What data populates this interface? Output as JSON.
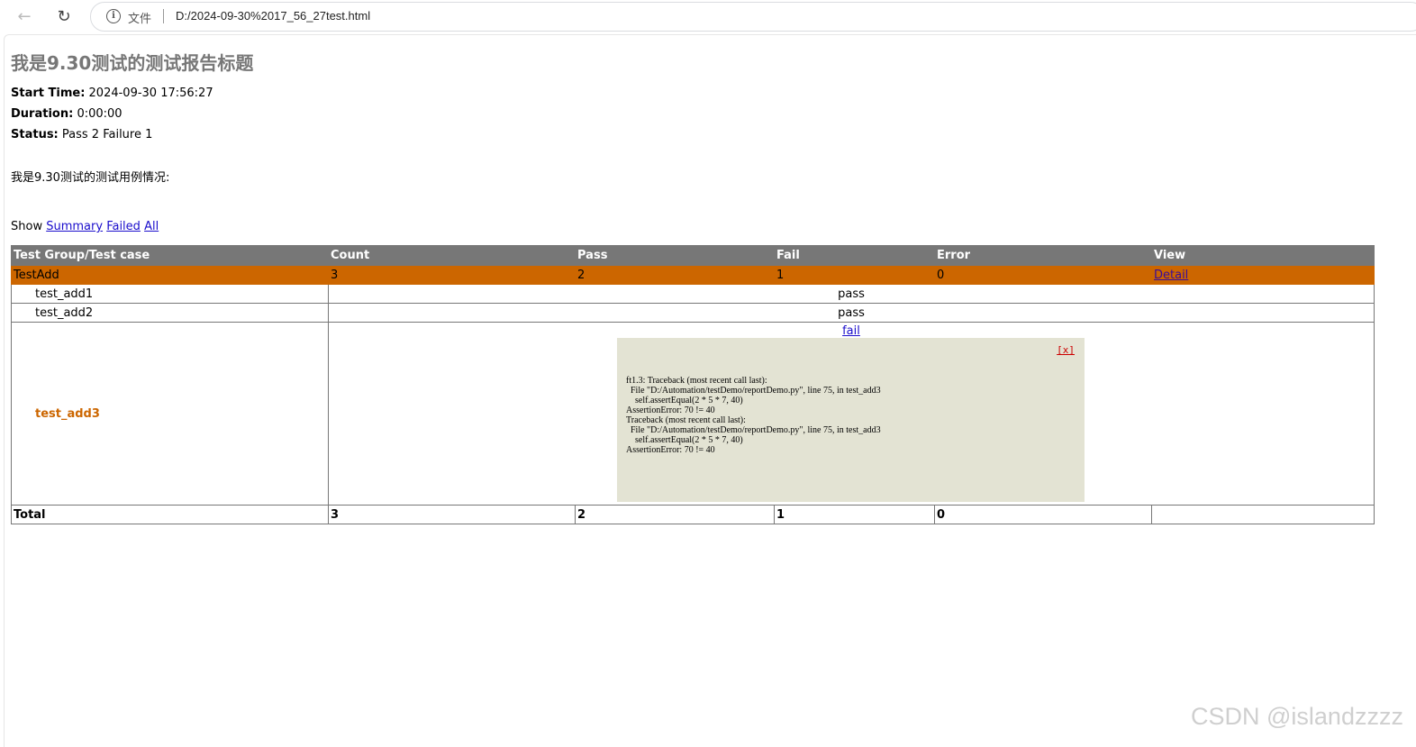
{
  "browser": {
    "scheme_label": "文件",
    "url": "D:/2024-09-30%2017_56_27test.html",
    "info_icon": "info-icon",
    "back_icon": "arrow-left-icon",
    "reload_icon": "reload-icon"
  },
  "report": {
    "title": "我是9.30测试的测试报告标题",
    "start_time_label": "Start Time:",
    "start_time": "2024-09-30 17:56:27",
    "duration_label": "Duration:",
    "duration": "0:00:00",
    "status_label": "Status:",
    "status": "Pass 2 Failure 1",
    "description": "我是9.30测试的测试用例情况:",
    "show_label": "Show",
    "show_links": [
      "Summary",
      "Failed",
      "All"
    ]
  },
  "table": {
    "headers": [
      "Test Group/Test case",
      "Count",
      "Pass",
      "Fail",
      "Error",
      "View"
    ],
    "group": {
      "name": "TestAdd",
      "count": "3",
      "pass": "2",
      "fail": "1",
      "error": "0",
      "view": "Detail"
    },
    "cases": [
      {
        "name": "test_add1",
        "result": "pass"
      },
      {
        "name": "test_add2",
        "result": "pass"
      },
      {
        "name": "test_add3",
        "result": "fail"
      }
    ],
    "popup": {
      "close": "[x]",
      "trace": "ft1.3: Traceback (most recent call last):\n  File \"D:/Automation/testDemo/reportDemo.py\", line 75, in test_add3\n    self.assertEqual(2 * 5 * 7, 40)\nAssertionError: 70 != 40\nTraceback (most recent call last):\n  File \"D:/Automation/testDemo/reportDemo.py\", line 75, in test_add3\n    self.assertEqual(2 * 5 * 7, 40)\nAssertionError: 70 != 40"
    },
    "total": {
      "label": "Total",
      "count": "3",
      "pass": "2",
      "fail": "1",
      "error": "0"
    }
  },
  "watermark": "CSDN @islandzzzz",
  "colors": {
    "header_bg": "#777777",
    "group_bg": "#cc6600",
    "popup_bg": "#e3e3d3",
    "fail_text": "#cc6600"
  }
}
